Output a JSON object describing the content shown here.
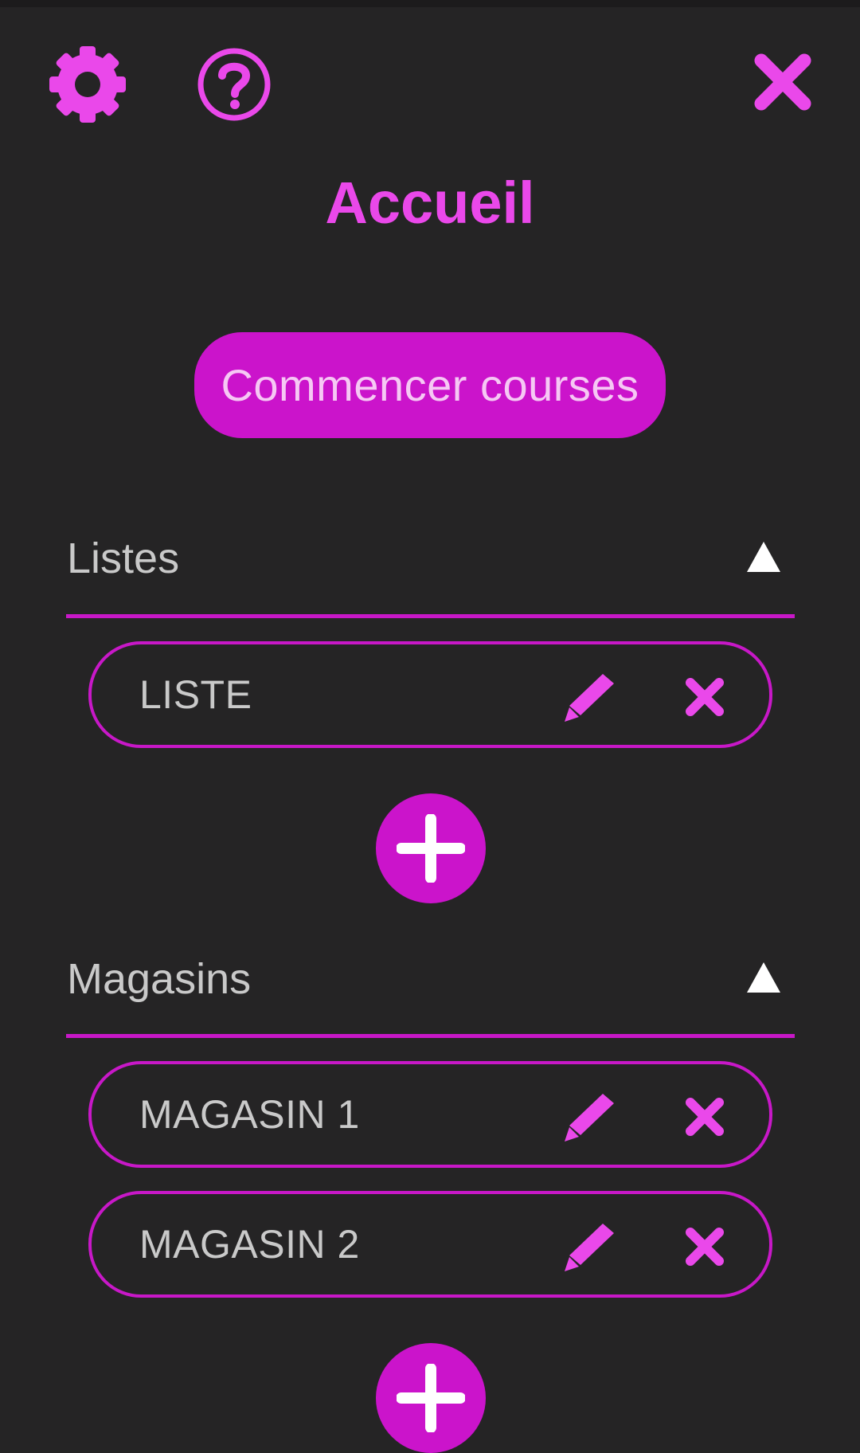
{
  "app": {
    "title": "Accueil",
    "accent_color": "#ea48ea",
    "background_color": "#252425"
  },
  "toolbar": {
    "settings_icon": "gear-icon",
    "help_icon": "help-circle-icon",
    "close_icon": "close-icon"
  },
  "primary_action": {
    "label": "Commencer courses"
  },
  "sections": {
    "lists": {
      "title": "Listes",
      "toggle_icon": "triangle-up-icon",
      "items": [
        {
          "label": "LISTE"
        }
      ]
    },
    "stores": {
      "title": "Magasins",
      "toggle_icon": "triangle-up-icon",
      "items": [
        {
          "label": "MAGASIN 1"
        },
        {
          "label": "MAGASIN 2"
        }
      ]
    }
  }
}
